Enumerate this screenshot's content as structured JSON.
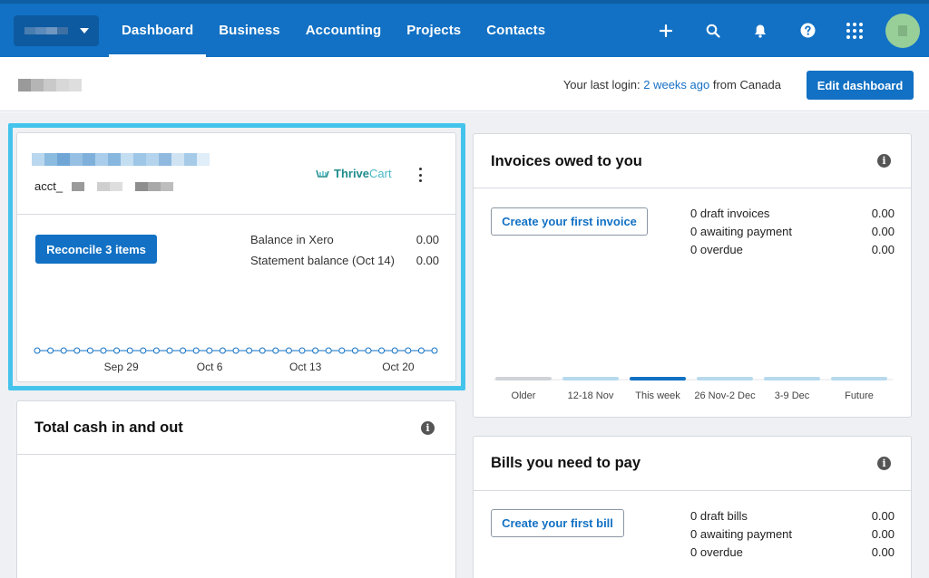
{
  "nav": {
    "links": [
      "Dashboard",
      "Business",
      "Accounting",
      "Projects",
      "Contacts"
    ],
    "active": "Dashboard",
    "icons": [
      "plus-icon",
      "search-icon",
      "bell-icon",
      "help-icon",
      "apps-grid-icon",
      "user-avatar"
    ]
  },
  "subheader": {
    "last_login_prefix": "Your last login: ",
    "last_login_link": "2 weeks ago",
    "last_login_suffix": " from Canada",
    "edit_dashboard": "Edit dashboard"
  },
  "bank_card": {
    "account_prefix": "acct_",
    "integration_name_a": "Thrive",
    "integration_name_b": "Cart",
    "reconcile_button": "Reconcile 3 items",
    "balance_rows": [
      {
        "label": "Balance in Xero",
        "value": "0.00"
      },
      {
        "label": "Statement balance (Oct 14)",
        "value": "0.00"
      }
    ],
    "chart_ticks": [
      "Sep 29",
      "Oct 6",
      "Oct 13",
      "Oct 20"
    ],
    "chart_point_count": 31
  },
  "invoices_card": {
    "title": "Invoices owed to you",
    "create_button": "Create your first invoice",
    "stats": [
      {
        "label": "0 draft invoices",
        "value": "0.00"
      },
      {
        "label": "0 awaiting payment",
        "value": "0.00"
      },
      {
        "label": "0 overdue",
        "value": "0.00"
      }
    ],
    "chart_categories": [
      "Older",
      "12-18 Nov",
      "This week",
      "26 Nov-2 Dec",
      "3-9 Dec",
      "Future"
    ],
    "highlighted_category": "This week"
  },
  "cash_card": {
    "title": "Total cash in and out"
  },
  "bills_card": {
    "title": "Bills you need to pay",
    "create_button": "Create your first bill",
    "stats": [
      {
        "label": "0 draft bills",
        "value": "0.00"
      },
      {
        "label": "0 awaiting payment",
        "value": "0.00"
      },
      {
        "label": "0 overdue",
        "value": "0.00"
      }
    ]
  },
  "colors": {
    "brand_blue": "#1271c4",
    "highlight_cyan": "#44c4ec",
    "canvas_bg": "#eef0f3"
  }
}
